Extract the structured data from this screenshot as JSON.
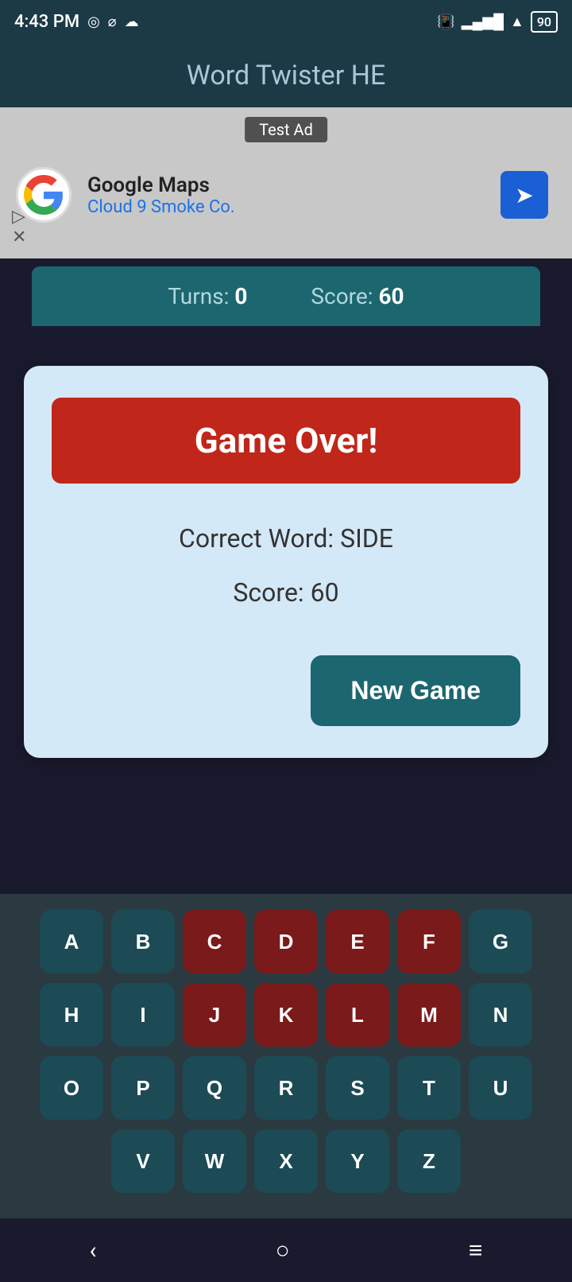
{
  "statusBar": {
    "time": "4:43 PM",
    "battery": "90"
  },
  "header": {
    "title": "Word Twister HE"
  },
  "ad": {
    "testLabel": "Test Ad",
    "businessName": "Google Maps",
    "businessSub": "Cloud 9 Smoke Co."
  },
  "stats": {
    "turnsLabel": "Turns:",
    "turnsValue": "0",
    "scoreLabel": "Score:",
    "scoreValue": "60"
  },
  "modal": {
    "gameOverText": "Game Over!",
    "correctWordLabel": "Correct Word: SIDE",
    "scoreLabel": "Score: 60",
    "newGameButton": "New Game"
  },
  "keyboard": {
    "rows": [
      [
        "A",
        "B",
        "C",
        "D",
        "E",
        "F",
        "G"
      ],
      [
        "H",
        "I",
        "J",
        "K",
        "L",
        "M",
        "N"
      ],
      [
        "O",
        "P",
        "Q",
        "R",
        "S",
        "T",
        "U"
      ],
      [
        "V",
        "W",
        "X",
        "Y",
        "Z"
      ]
    ],
    "usedKeys": [
      "C",
      "D",
      "E",
      "F",
      "J",
      "K",
      "L",
      "M"
    ]
  },
  "navBar": {
    "backIcon": "‹",
    "homeIcon": "○",
    "menuIcon": "≡"
  }
}
